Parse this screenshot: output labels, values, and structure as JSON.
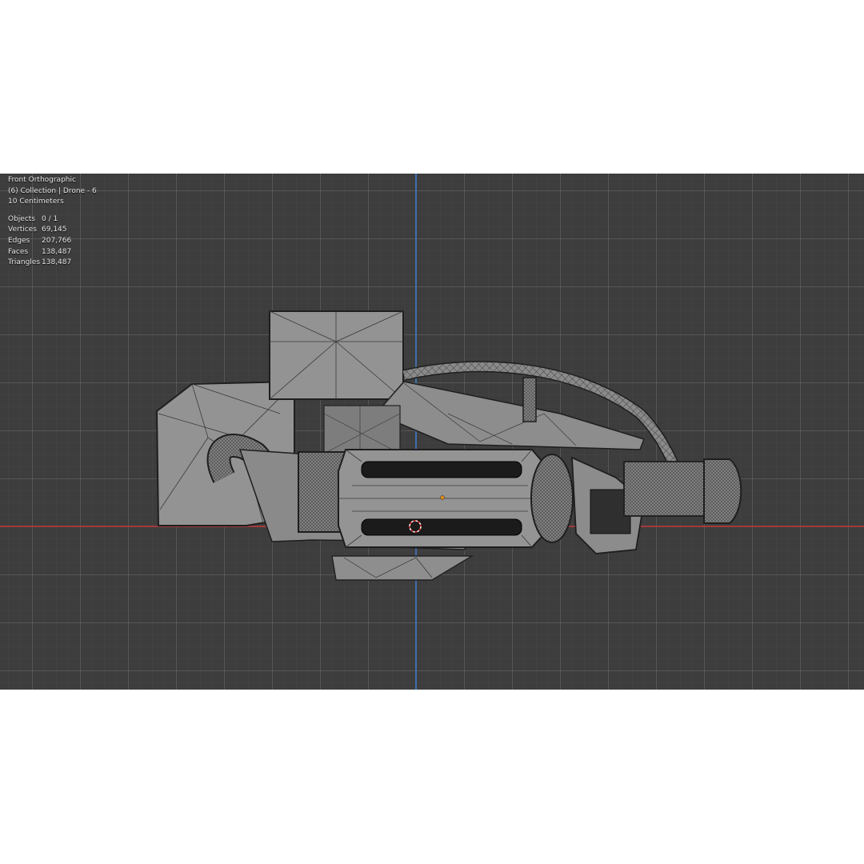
{
  "viewport": {
    "view_name": "Front Orthographic",
    "collection": "(6) Collection | Drone - 6",
    "scale": "10 Centimeters",
    "colors": {
      "background": "#3d3d3d",
      "x_axis": "#a33a3a",
      "y_axis": "#3f6fa8",
      "mesh": "#8c8c8c"
    }
  },
  "stats": [
    {
      "key": "Objects",
      "value": "0 / 1"
    },
    {
      "key": "Vertices",
      "value": "69,145"
    },
    {
      "key": "Edges",
      "value": "207,766"
    },
    {
      "key": "Faces",
      "value": "138,487"
    },
    {
      "key": "Triangles",
      "value": "138,487"
    }
  ],
  "icons": {
    "cursor": "3d-cursor-icon",
    "origin": "object-origin-icon"
  }
}
